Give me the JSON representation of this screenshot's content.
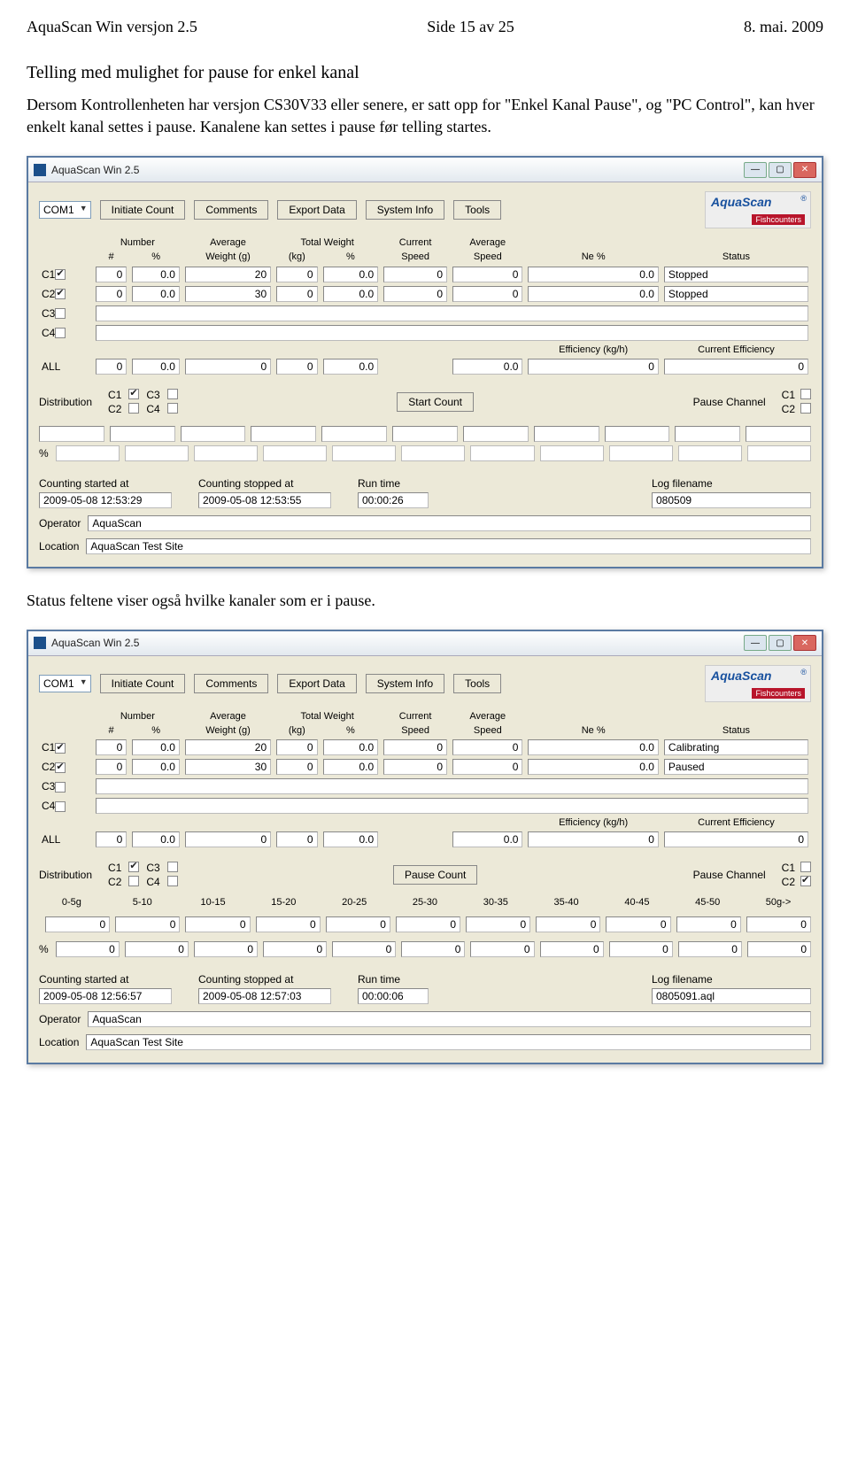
{
  "doc": {
    "header_left": "AquaScan Win versjon 2.5",
    "header_center": "Side 15 av 25",
    "header_right": "8. mai. 2009",
    "title": "Telling med mulighet for pause for enkel kanal",
    "para1": "Dersom Kontrollenheten har versjon CS30V33 eller senere, er satt opp for \"Enkel Kanal Pause\", og \"PC Control\", kan hver enkelt kanal settes i pause. Kanalene kan settes i pause før telling startes.",
    "para2": "Status feltene viser også hvilke kanaler som er i pause."
  },
  "common": {
    "window_title": "AquaScan Win 2.5",
    "com": "COM1",
    "buttons": {
      "initiate": "Initiate Count",
      "comments": "Comments",
      "export": "Export Data",
      "sysinfo": "System Info",
      "tools": "Tools"
    },
    "logo": {
      "brand": "AquaScan",
      "sub": "Fishcounters",
      "reg": "®"
    },
    "headers": {
      "number": "Number",
      "hash": "#",
      "pct": "%",
      "avgw": "Average",
      "avgw2": "Weight (g)",
      "totw": "Total Weight",
      "kg": "(kg)",
      "curspd": "Current",
      "speed": "Speed",
      "avgspd": "Average",
      "ne": "Ne %",
      "status": "Status",
      "eff": "Efficiency (kg/h)",
      "cureff": "Current Efficiency"
    },
    "labels": {
      "distribution": "Distribution",
      "pause_channel": "Pause Channel",
      "counting_started": "Counting started at",
      "counting_stopped": "Counting stopped at",
      "runtime": "Run time",
      "logfile": "Log filename",
      "operator": "Operator",
      "location": "Location",
      "all": "ALL",
      "pctlabel": "%"
    },
    "channels": [
      "C1",
      "C2",
      "C3",
      "C4"
    ]
  },
  "win1": {
    "rows": [
      {
        "ch": "C1",
        "checked": true,
        "num": "0",
        "pct": "0.0",
        "avgw": "20",
        "totw": "0",
        "totpct": "0.0",
        "cur": "0",
        "avg": "0",
        "ne": "0.0",
        "status": "Stopped"
      },
      {
        "ch": "C2",
        "checked": true,
        "num": "0",
        "pct": "0.0",
        "avgw": "30",
        "totw": "0",
        "totpct": "0.0",
        "cur": "0",
        "avg": "0",
        "ne": "0.0",
        "status": "Stopped"
      },
      {
        "ch": "C3",
        "checked": false
      },
      {
        "ch": "C4",
        "checked": false
      }
    ],
    "all": {
      "num": "0",
      "pct": "0.0",
      "avgw": "0",
      "totw": "0",
      "totpct": "0.0",
      "ne": "0.0",
      "eff": "0",
      "cureff": "0"
    },
    "dist": {
      "c1": true,
      "c2": false,
      "c3": false,
      "c4": false
    },
    "mid_button": "Start Count",
    "pause": {
      "c1": false,
      "c2": false
    },
    "started": "2009-05-08 12:53:29",
    "stopped": "2009-05-08 12:53:55",
    "runtime": "00:00:26",
    "logfile": "080509",
    "operator": "AquaScan",
    "location": "AquaScan Test Site"
  },
  "win2": {
    "rows": [
      {
        "ch": "C1",
        "checked": true,
        "num": "0",
        "pct": "0.0",
        "avgw": "20",
        "totw": "0",
        "totpct": "0.0",
        "cur": "0",
        "avg": "0",
        "ne": "0.0",
        "status": "Calibrating"
      },
      {
        "ch": "C2",
        "checked": true,
        "num": "0",
        "pct": "0.0",
        "avgw": "30",
        "totw": "0",
        "totpct": "0.0",
        "cur": "0",
        "avg": "0",
        "ne": "0.0",
        "status": "Paused"
      },
      {
        "ch": "C3",
        "checked": false
      },
      {
        "ch": "C4",
        "checked": false
      }
    ],
    "all": {
      "num": "0",
      "pct": "0.0",
      "avgw": "0",
      "totw": "0",
      "totpct": "0.0",
      "ne": "0.0",
      "eff": "0",
      "cureff": "0"
    },
    "dist": {
      "c1": true,
      "c2": false,
      "c3": false,
      "c4": false
    },
    "mid_button": "Pause Count",
    "pause": {
      "c1": false,
      "c2": true
    },
    "hist_labels": [
      "0-5g",
      "5-10",
      "10-15",
      "15-20",
      "20-25",
      "25-30",
      "30-35",
      "35-40",
      "40-45",
      "45-50",
      "50g->"
    ],
    "hist_row1": [
      "0",
      "0",
      "0",
      "0",
      "0",
      "0",
      "0",
      "0",
      "0",
      "0",
      "0"
    ],
    "hist_row2": [
      "0",
      "0",
      "0",
      "0",
      "0",
      "0",
      "0",
      "0",
      "0",
      "0",
      "0"
    ],
    "started": "2009-05-08 12:56:57",
    "stopped": "2009-05-08 12:57:03",
    "runtime": "00:00:06",
    "logfile": "0805091.aql",
    "operator": "AquaScan",
    "location": "AquaScan Test Site"
  }
}
